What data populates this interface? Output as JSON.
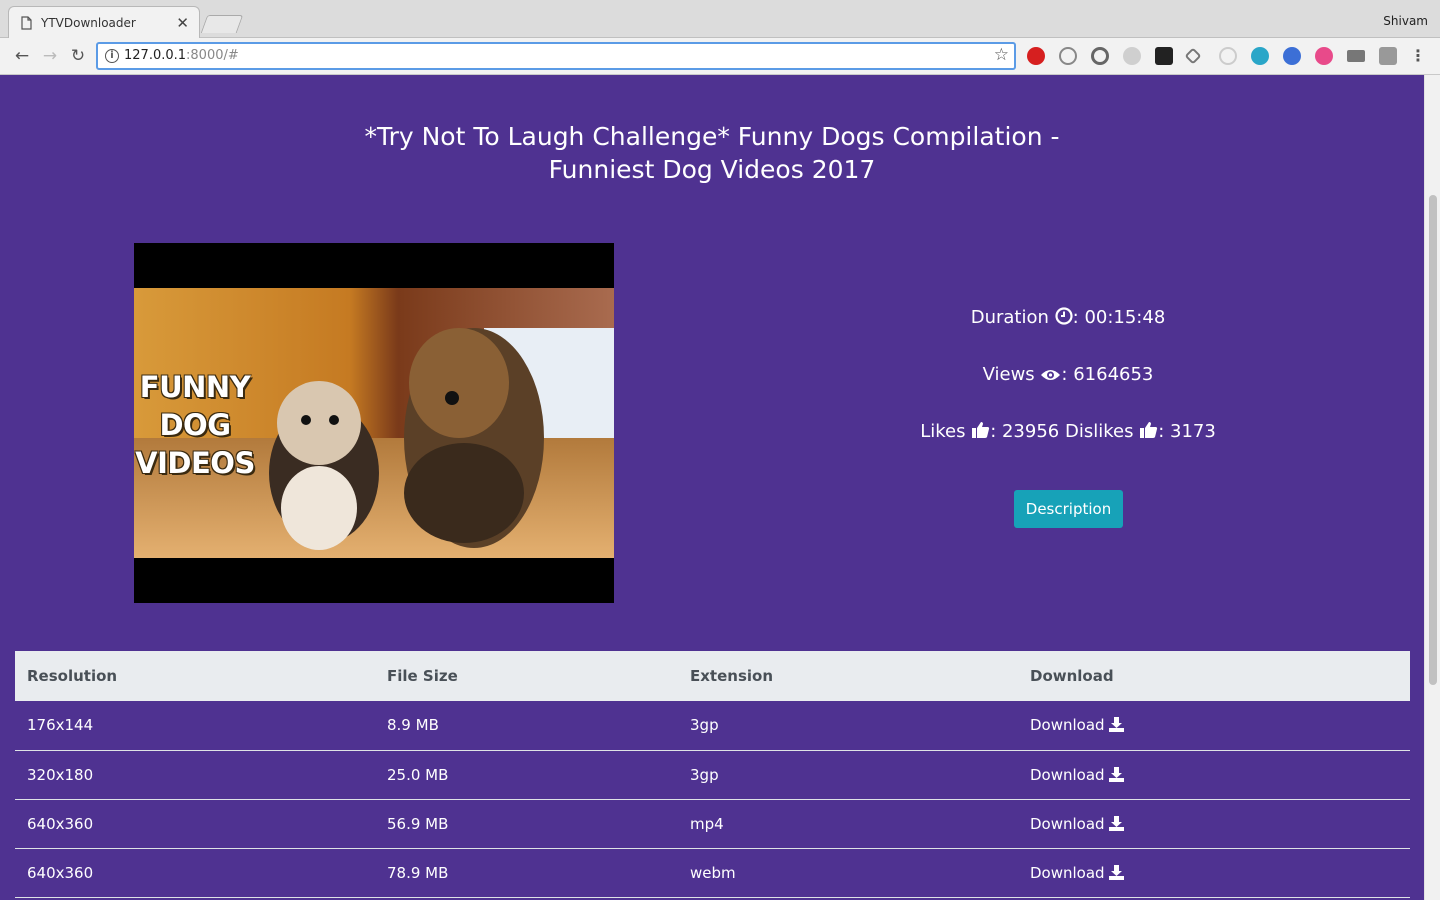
{
  "browser": {
    "tab_title": "YTVDownloader",
    "profile_name": "Shivam",
    "url_host": "127.0.0.1",
    "url_rest": ":8000/#"
  },
  "video": {
    "title": "*Try Not To Laugh Challenge* Funny Dogs Compilation - Funniest Dog Videos 2017",
    "thumbnail_text": [
      "FUNNY",
      "DOG",
      "VIDEOS"
    ],
    "duration_label": "Duration",
    "duration": "00:15:48",
    "views_label": "Views",
    "views": "6164653",
    "likes_label": "Likes",
    "likes": "23956",
    "dislikes_label": "Dislikes",
    "dislikes": "3173",
    "description_button": "Description"
  },
  "table": {
    "headers": [
      "Resolution",
      "File Size",
      "Extension",
      "Download"
    ],
    "rows": [
      {
        "resolution": "176x144",
        "size": "8.9 MB",
        "ext": "3gp",
        "link": "Download"
      },
      {
        "resolution": "320x180",
        "size": "25.0 MB",
        "ext": "3gp",
        "link": "Download"
      },
      {
        "resolution": "640x360",
        "size": "56.9 MB",
        "ext": "mp4",
        "link": "Download"
      },
      {
        "resolution": "640x360",
        "size": "78.9 MB",
        "ext": "webm",
        "link": "Download"
      }
    ]
  },
  "colors": {
    "page_bg": "#4f3291",
    "button_bg": "#17a2b8",
    "table_header_bg": "#e9ecef"
  },
  "icons": [
    "document-icon",
    "close-icon",
    "back-icon",
    "forward-icon",
    "reload-icon",
    "info-icon",
    "star-icon",
    "clock-icon",
    "eye-icon",
    "thumbs-up-icon",
    "download-icon",
    "menu-icon"
  ]
}
